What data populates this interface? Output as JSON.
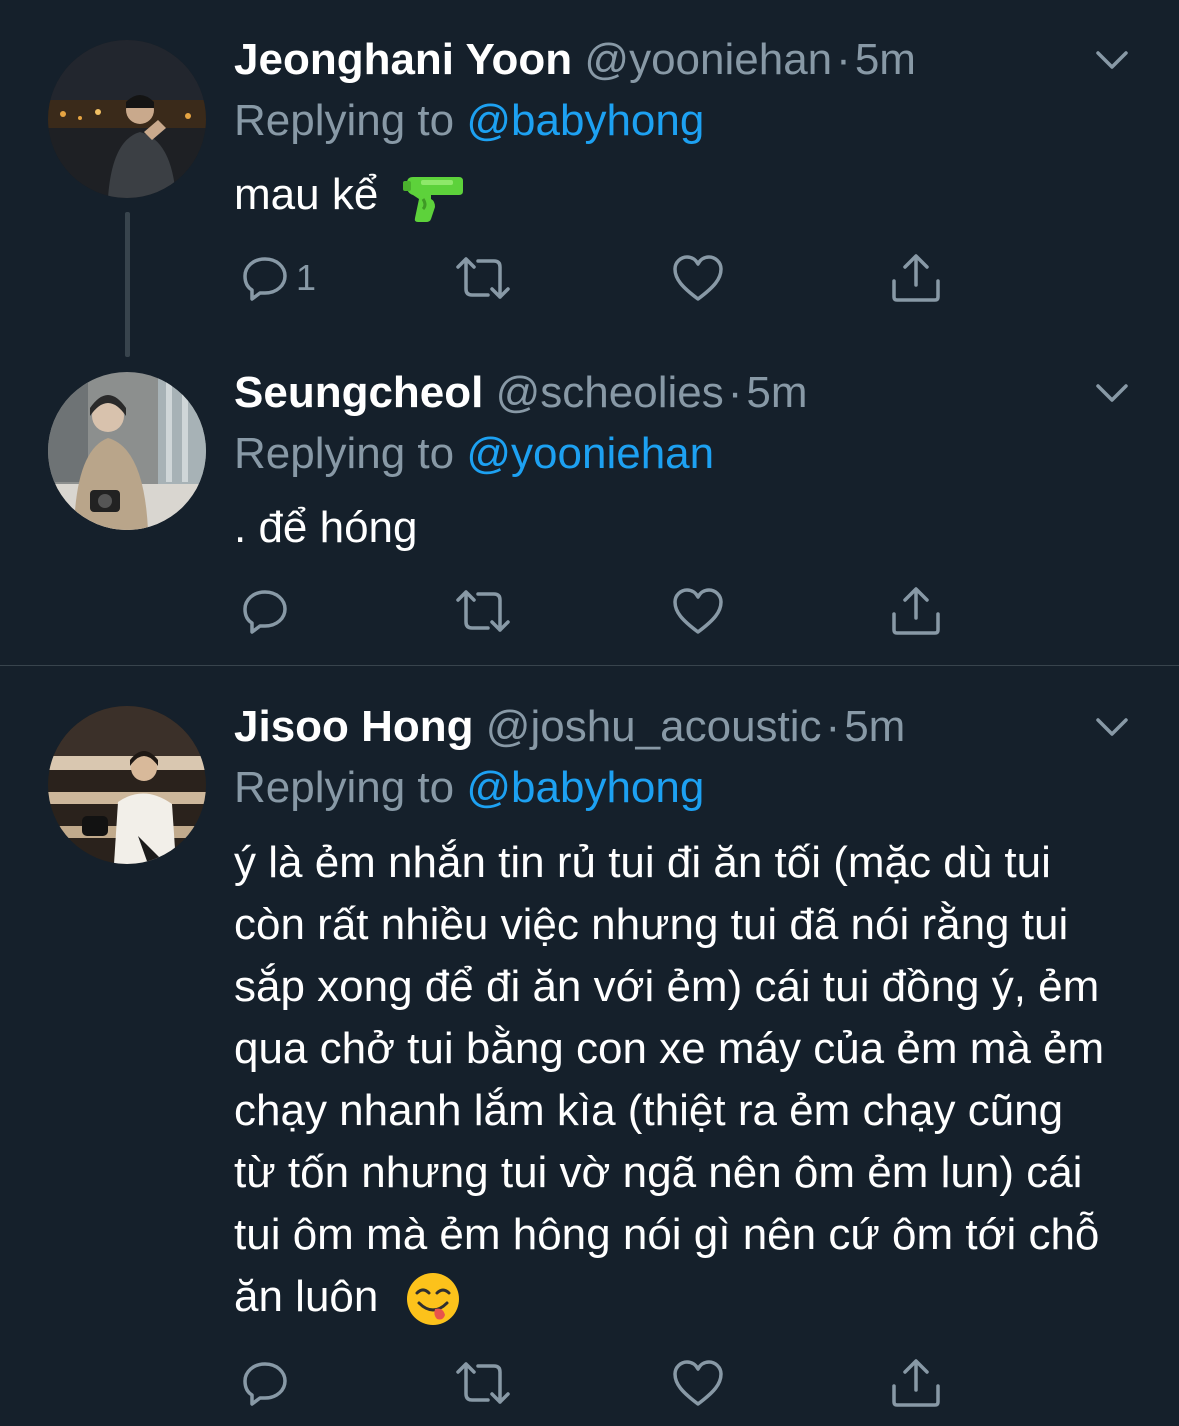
{
  "colors": {
    "background": "#15202b",
    "secondary_text": "#8899a6",
    "link": "#1da1f2",
    "divider": "#38444d"
  },
  "tweets": [
    {
      "name": "Jeonghani Yoon",
      "handle": "@yooniehan",
      "separator": "·",
      "time": "5m",
      "replying_label": "Replying to",
      "replying_to": "@babyhong",
      "text": "mau kể",
      "emoji": "water-pistol-emoji",
      "reply_count": "1"
    },
    {
      "name": "Seungcheol",
      "handle": "@scheolies",
      "separator": "·",
      "time": "5m",
      "replying_label": "Replying to",
      "replying_to": "@yooniehan",
      "text": ". để hóng",
      "reply_count": ""
    },
    {
      "name": "Jisoo Hong",
      "handle": "@joshu_acoustic",
      "separator": "·",
      "time": "5m",
      "replying_label": "Replying to",
      "replying_to": "@babyhong",
      "text": "ý là ẻm nhắn tin rủ tui đi ăn tối (mặc dù tui còn rất nhiều việc nhưng tui đã nói rằng tui sắp xong để đi ăn với ẻm) cái tui đồng ý, ẻm qua chở tui bằng con xe máy của ẻm mà ẻm chạy nhanh lắm kìa (thiệt ra ẻm chạy cũng từ tốn nhưng tui vờ ngã nên ôm ẻm lun) cái tui ôm mà ẻm hông nói gì nên cứ ôm tới chỗ ăn luôn",
      "emoji": "face-savoring-food-emoji",
      "reply_count": ""
    }
  ]
}
